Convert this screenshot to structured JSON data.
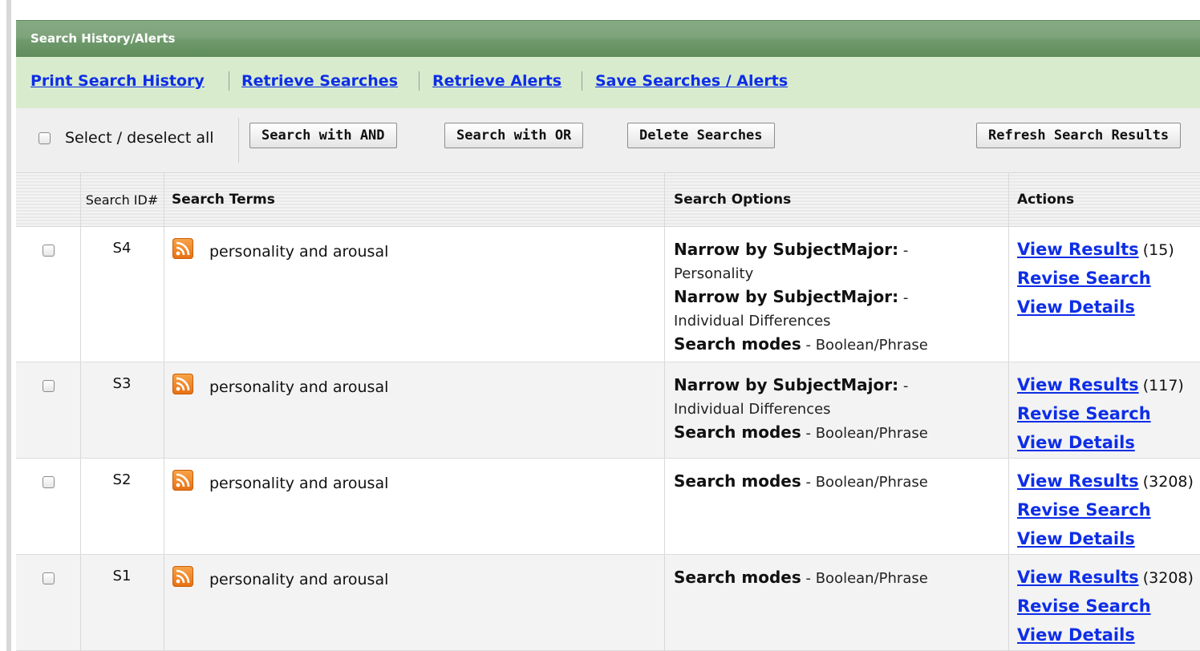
{
  "panel": {
    "title": "Search History/Alerts"
  },
  "links": [
    {
      "label": "Print Search History"
    },
    {
      "label": "Retrieve Searches"
    },
    {
      "label": "Retrieve Alerts"
    },
    {
      "label": "Save Searches / Alerts"
    }
  ],
  "toolbar": {
    "select_all_label": "Select / deselect all",
    "and_label": "Search with AND",
    "or_label": "Search with OR",
    "delete_label": "Delete Searches",
    "refresh_label": "Refresh Search Results"
  },
  "columns": {
    "search_id": "Search ID#",
    "search_terms": "Search Terms",
    "search_options": "Search Options",
    "actions": "Actions"
  },
  "rows": [
    {
      "id": "S4",
      "terms": "personality and arousal",
      "options": [
        {
          "key": "Narrow by SubjectMajor:",
          "sep": " - ",
          "value": ""
        },
        {
          "key": "",
          "sep": "",
          "value": "Personality"
        },
        {
          "key": "Narrow by SubjectMajor:",
          "sep": " - ",
          "value": ""
        },
        {
          "key": "",
          "sep": "",
          "value": "Individual Differences"
        },
        {
          "key": "Search modes",
          "sep": " - ",
          "value": "Boolean/Phrase"
        }
      ],
      "view_results": "View Results",
      "count": "(15)",
      "revise": "Revise Search",
      "details": "View Details"
    },
    {
      "id": "S3",
      "terms": "personality and arousal",
      "options": [
        {
          "key": "Narrow by SubjectMajor:",
          "sep": " - ",
          "value": ""
        },
        {
          "key": "",
          "sep": "",
          "value": "Individual Differences"
        },
        {
          "key": "Search modes",
          "sep": " - ",
          "value": "Boolean/Phrase"
        }
      ],
      "view_results": "View Results",
      "count": "(117)",
      "revise": "Revise Search",
      "details": "View Details"
    },
    {
      "id": "S2",
      "terms": "personality and arousal",
      "options": [
        {
          "key": "Search modes",
          "sep": " - ",
          "value": "Boolean/Phrase"
        }
      ],
      "view_results": "View Results",
      "count": "(3208)",
      "revise": "Revise Search",
      "details": "View Details"
    },
    {
      "id": "S1",
      "terms": "personality and arousal",
      "options": [
        {
          "key": "Search modes",
          "sep": " - ",
          "value": "Boolean/Phrase"
        }
      ],
      "view_results": "View Results",
      "count": "(3208)",
      "revise": "Revise Search",
      "details": "View Details"
    }
  ],
  "icons": {
    "rss": "rss-feed-icon"
  },
  "colors": {
    "header_green": "#6f9a6c",
    "links_bar": "#d8eccd",
    "link_blue": "#0e2ee6",
    "rss_orange": "#e86f10"
  }
}
